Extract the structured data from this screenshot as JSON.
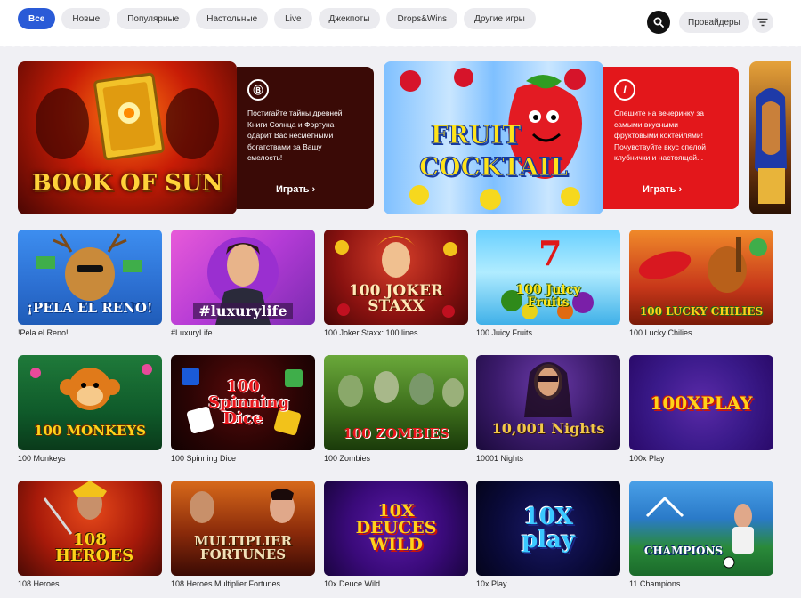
{
  "filters": {
    "chips": [
      "Все",
      "Новые",
      "Популярные",
      "Настольные",
      "Live",
      "Джекпоты",
      "Drops&Wins",
      "Другие игры"
    ],
    "active_index": 0,
    "providers_label": "Провайдеры"
  },
  "banners": [
    {
      "title": "BOOK OF SUN",
      "provider_logo": "Ⓑ",
      "description": "Постигайте тайны древней Книги Солнца и Фортуна одарит Вас несметными богатствами за Вашу смелость!",
      "play_label": "Играть ›",
      "panel_color": "#3a0a06"
    },
    {
      "title_line1": "FRUIT",
      "title_line2": "COCKTAIL",
      "provider_logo": "I",
      "description": "Спешите на вечеринку за самыми вкусными фруктовыми коктейлями! Почувствуйте вкус спелой клубнички и настоящей...",
      "play_label": "Играть ›",
      "panel_color": "#e3171b"
    }
  ],
  "games": [
    {
      "name": "!Pela el Reno!",
      "art": "¡PELA EL RENO!"
    },
    {
      "name": "#LuxuryLife",
      "art": "#luxurylife"
    },
    {
      "name": "100 Joker Staxx: 100 lines",
      "art": "100 JOKER STAXX"
    },
    {
      "name": "100 Juicy Fruits",
      "art": "100 Juicy Fruits"
    },
    {
      "name": "100 Lucky Chilies",
      "art": "100 LUCKY CHILIES"
    },
    {
      "name": "100 Monkeys",
      "art": "100 MONKEYS"
    },
    {
      "name": "100 Spinning Dice",
      "art": "100 Spinning Dice"
    },
    {
      "name": "100 Zombies",
      "art": "100 ZOMBIES"
    },
    {
      "name": "10001 Nights",
      "art": "10,001 Nights"
    },
    {
      "name": "100x Play",
      "art": "100XPLAY"
    },
    {
      "name": "108 Heroes",
      "art": "108 HEROES"
    },
    {
      "name": "108 Heroes Multiplier Fortunes",
      "art": "MULTIPLIER FORTUNES"
    },
    {
      "name": "10x Deuce Wild",
      "art": "10X DEUCES WILD"
    },
    {
      "name": "10x Play",
      "art": "10X play"
    },
    {
      "name": "11 Champions",
      "art": "CHAMPIONS"
    }
  ]
}
